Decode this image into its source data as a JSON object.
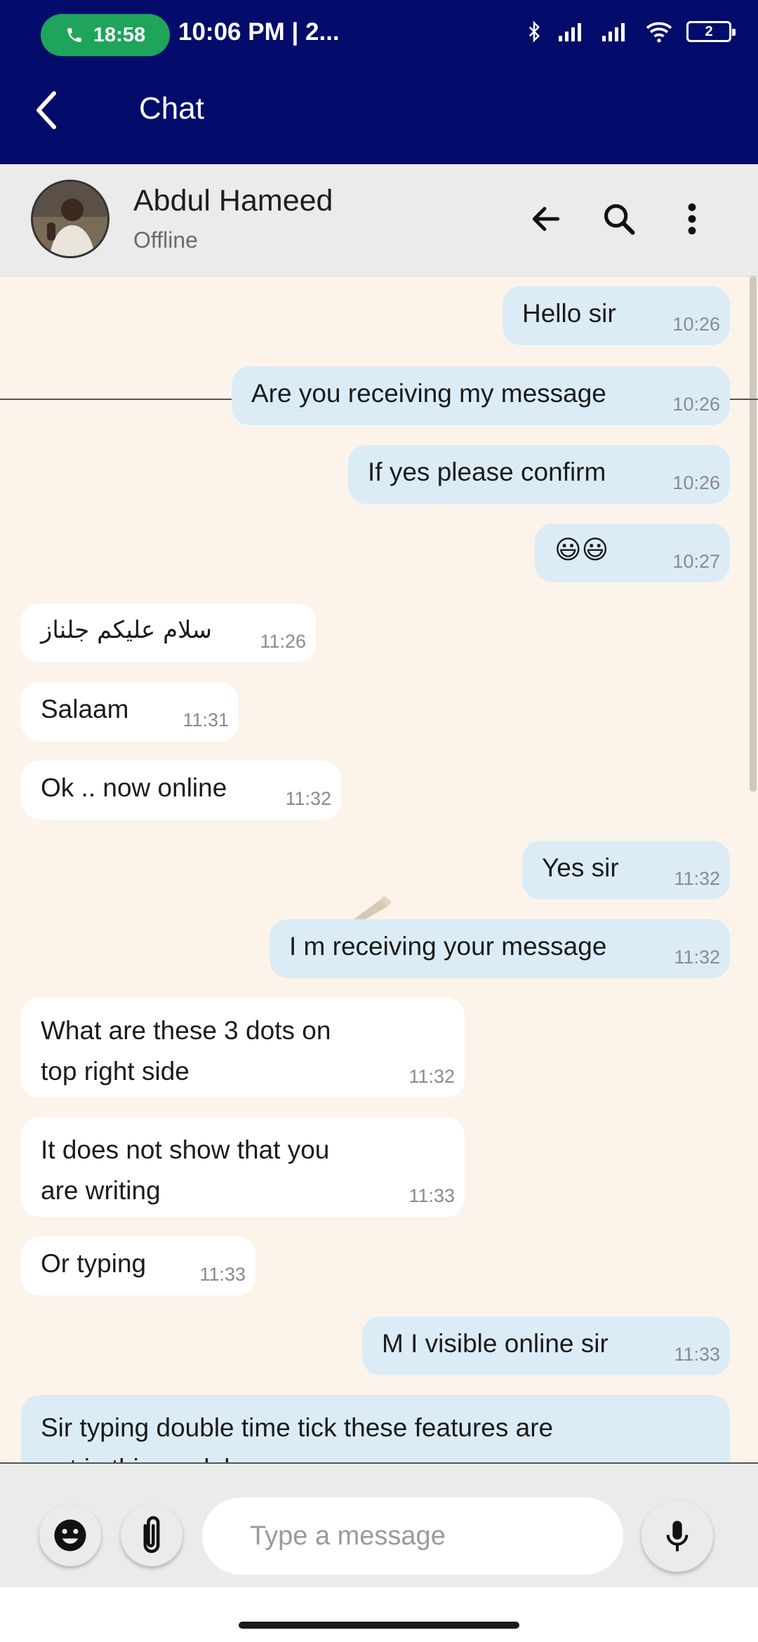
{
  "status_bar": {
    "call_timer": "18:58",
    "time": "10:06 PM",
    "extra": "| 2...",
    "battery": "2"
  },
  "app_bar": {
    "title": "Chat"
  },
  "contact": {
    "name": "Abdul Hameed",
    "status": "Offline"
  },
  "messages": [
    {
      "dir": "out",
      "text": "Hello sir",
      "time": "10:26"
    },
    {
      "dir": "out",
      "text": "Are you receiving my message",
      "time": "10:26"
    },
    {
      "dir": "out",
      "text": "If yes please confirm",
      "time": "10:26"
    },
    {
      "dir": "out",
      "text": "😃😃",
      "time": "10:27"
    },
    {
      "dir": "in",
      "text": "سلام علیکم جلناز",
      "time": "11:26"
    },
    {
      "dir": "in",
      "text": "Salaam",
      "time": "11:31"
    },
    {
      "dir": "in",
      "text": "Ok .. now online",
      "time": "11:32"
    },
    {
      "dir": "out",
      "text": "Yes sir",
      "time": "11:32"
    },
    {
      "dir": "out",
      "text": "I m receiving your message",
      "time": "11:32"
    },
    {
      "dir": "in",
      "text": "What are these 3 dots on\ntop right side",
      "time": "11:32"
    },
    {
      "dir": "in",
      "text": "It does not show that you\nare writing",
      "time": "11:33"
    },
    {
      "dir": "in",
      "text": "Or typing",
      "time": "11:33"
    },
    {
      "dir": "out",
      "text": "M I visible online sir",
      "time": "11:33"
    },
    {
      "dir": "out",
      "text": "Sir typing double time tick these features are\nnot in this module",
      "time": ""
    }
  ],
  "input": {
    "placeholder": "Type a message"
  },
  "colors": {
    "primary": "#030c6b",
    "call": "#1ea45b",
    "outgoing": "#dcecf7",
    "incoming": "#ffffff",
    "chat_bg": "#fcf4ea"
  }
}
